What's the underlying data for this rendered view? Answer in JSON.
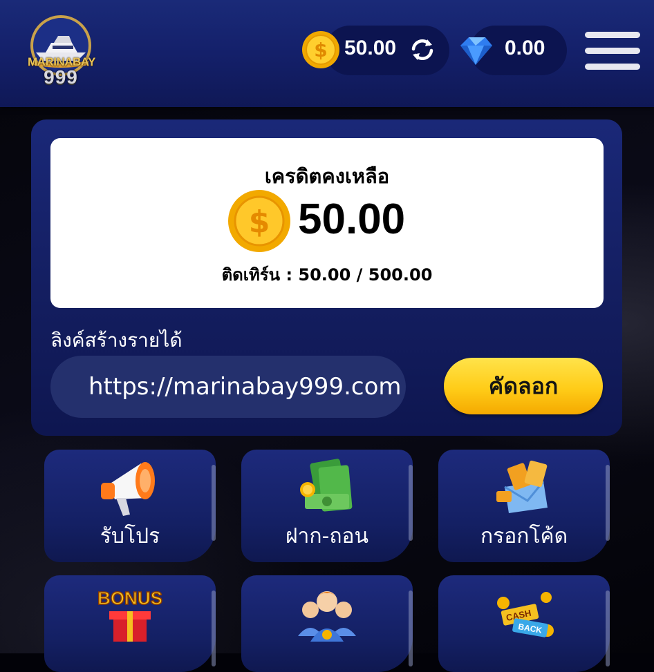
{
  "header": {
    "logo": {
      "name": "MARINABAY",
      "number": "999"
    },
    "coin_balance": "50.00",
    "gem_balance": "0.00"
  },
  "credit": {
    "title": "เครดิตคงเหลือ",
    "amount": "50.00",
    "turnover": "ติดเทิร์น : 50.00 / 500.00"
  },
  "referral": {
    "label": "ลิงค์สร้างรายได้",
    "link": "https://marinabay999.com",
    "copy_label": "คัดลอก"
  },
  "menu_tiles": [
    {
      "label": "รับโปร",
      "icon": "megaphone-icon"
    },
    {
      "label": "ฝาก-ถอน",
      "icon": "money-stack-icon"
    },
    {
      "label": "กรอกโค้ด",
      "icon": "coupon-envelope-icon"
    },
    {
      "label": "",
      "icon": "bonus-gift-icon"
    },
    {
      "label": "",
      "icon": "team-icon"
    },
    {
      "label": "",
      "icon": "cashback-icon"
    }
  ],
  "colors": {
    "header_bg": "#14206a",
    "panel_bg": "#131d5e",
    "accent_yellow": "#ffcc18",
    "coin_gold": "#f5b400"
  }
}
